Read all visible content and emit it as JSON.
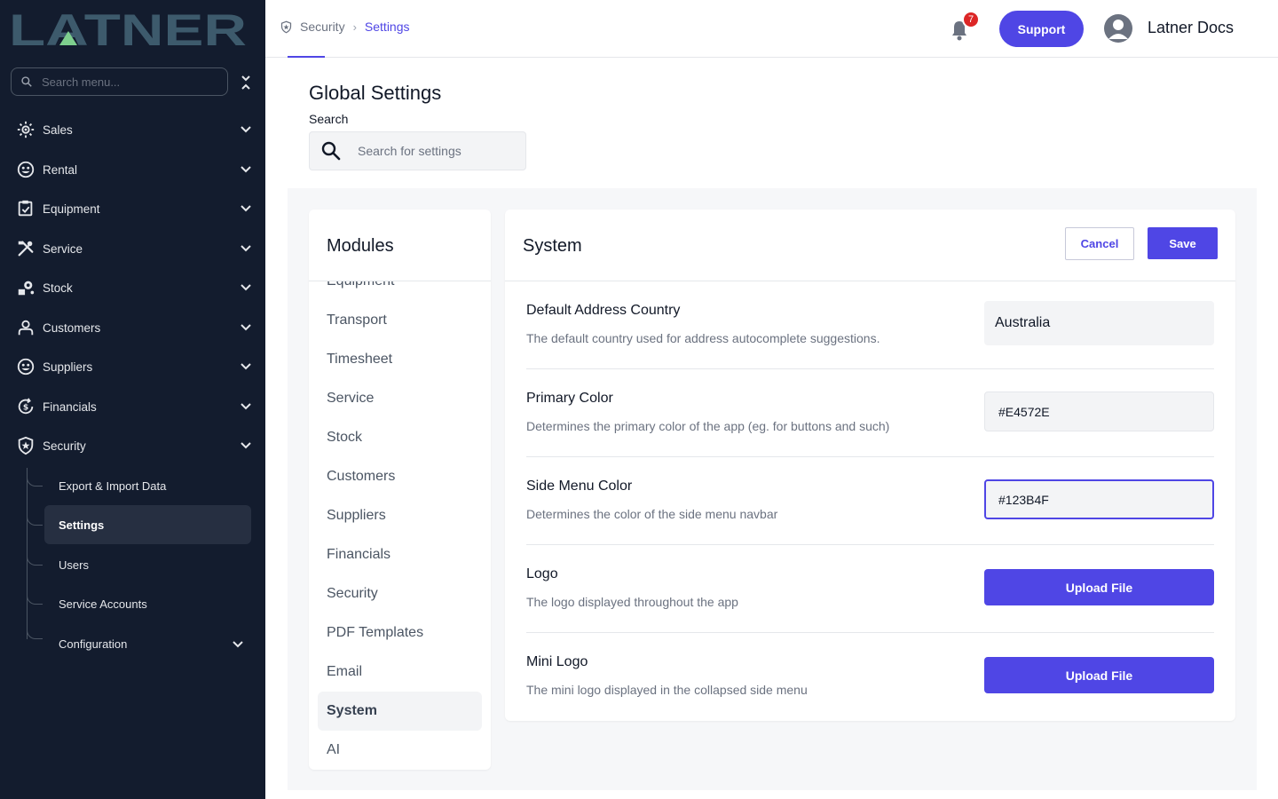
{
  "app": {
    "logo_text": "LATNER",
    "logo_color": "#3d5a6c",
    "accent_color": "#4f46e5",
    "sidebar_color": "#131c2e"
  },
  "sidebar": {
    "search_placeholder": "Search menu...",
    "items": [
      {
        "label": "Sales",
        "icon": "sales-icon"
      },
      {
        "label": "Rental",
        "icon": "rental-icon"
      },
      {
        "label": "Equipment",
        "icon": "equipment-icon"
      },
      {
        "label": "Service",
        "icon": "service-tools-icon"
      },
      {
        "label": "Stock",
        "icon": "stock-icon"
      },
      {
        "label": "Customers",
        "icon": "customers-icon"
      },
      {
        "label": "Suppliers",
        "icon": "suppliers-icon"
      },
      {
        "label": "Financials",
        "icon": "financials-icon"
      },
      {
        "label": "Security",
        "icon": "security-shield-icon"
      }
    ],
    "security_subitems": [
      {
        "label": "Export & Import Data"
      },
      {
        "label": "Settings",
        "active": true
      },
      {
        "label": "Users"
      },
      {
        "label": "Service Accounts"
      },
      {
        "label": "Configuration"
      }
    ]
  },
  "topbar": {
    "breadcrumb": [
      "Security",
      "Settings"
    ],
    "notification_count": "7",
    "support_label": "Support",
    "user_name": "Latner Docs"
  },
  "page": {
    "title": "Global Settings",
    "search_label": "Search",
    "search_placeholder": "Search for settings"
  },
  "modules": {
    "title": "Modules",
    "items": [
      "Equipment",
      "Transport",
      "Timesheet",
      "Service",
      "Stock",
      "Customers",
      "Suppliers",
      "Financials",
      "Security",
      "PDF Templates",
      "Email",
      "System",
      "AI"
    ],
    "active": "System"
  },
  "system": {
    "title": "System",
    "cancel_label": "Cancel",
    "save_label": "Save",
    "settings": [
      {
        "name": "Default Address Country",
        "description": "The default country used for address autocomplete suggestions.",
        "value": "Australia"
      },
      {
        "name": "Primary Color",
        "description": "Determines the primary color of the app (eg. for buttons and such)",
        "value": "#E4572E"
      },
      {
        "name": "Side Menu Color",
        "description": "Determines the color of the side menu navbar",
        "value": "#123B4F"
      },
      {
        "name": "Logo",
        "description": "The logo displayed throughout the app",
        "button": "Upload File"
      },
      {
        "name": "Mini Logo",
        "description": "The mini logo displayed in the collapsed side menu",
        "button": "Upload File"
      }
    ]
  }
}
